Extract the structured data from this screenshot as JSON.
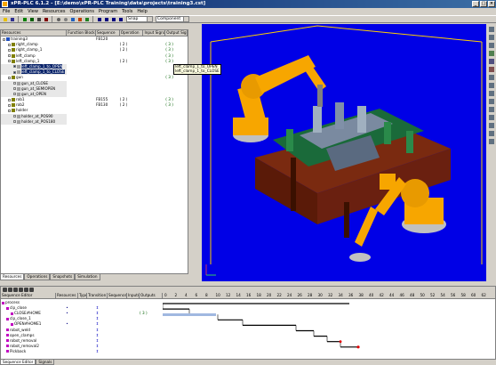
{
  "window": {
    "title": "xPR-PLC 6.1.2 - [E:\\demo\\xPR-PLC Training\\data\\projects\\training3.cst]"
  },
  "menu": [
    "File",
    "Edit",
    "View",
    "Resources",
    "Operations",
    "Program",
    "Tools",
    "Help"
  ],
  "toolbar": {
    "snap_combo": "Snap",
    "component_combo": "Component"
  },
  "tree": {
    "columns": [
      "Resources",
      "Function Block",
      "Sequence",
      "Operation",
      "Input Signals",
      "Output Signals"
    ],
    "rows": [
      {
        "name": "training3",
        "indent": 0,
        "sequence": "FB120",
        "operation": "",
        "input": "",
        "output": "",
        "sel": false
      },
      {
        "name": "right_clamp",
        "indent": 1,
        "sequence": "",
        "operation": "( 2 )",
        "input": "",
        "output": "( 3 )",
        "sel": false
      },
      {
        "name": "right_clamp_1",
        "indent": 1,
        "sequence": "",
        "operation": "( 2 )",
        "input": "",
        "output": "( 3 )",
        "sel": false
      },
      {
        "name": "left_clamp",
        "indent": 1,
        "sequence": "",
        "operation": "",
        "input": "",
        "output": "( 3 )",
        "sel": false
      },
      {
        "name": "left_clamp_1",
        "indent": 1,
        "sequence": "",
        "operation": "( 2 )",
        "input": "",
        "output": "( 3 )",
        "sel": false
      },
      {
        "name": "left_clamp_1_to_OPEN",
        "indent": 2,
        "sequence": "",
        "operation": "",
        "input": "",
        "output": "",
        "sel": true
      },
      {
        "name": "left_clamp_1_to_CLOSE",
        "indent": 2,
        "sequence": "",
        "operation": "",
        "input": "",
        "output": "",
        "sel": true
      },
      {
        "name": "gun",
        "indent": 1,
        "sequence": "",
        "operation": "",
        "input": "",
        "output": "( 3 )",
        "sel": false
      },
      {
        "name": "gun_at_CLOSE",
        "indent": 2,
        "sequence": "",
        "operation": "",
        "input": "",
        "output": "",
        "sel": false
      },
      {
        "name": "gun_at_SEMIOPEN",
        "indent": 2,
        "sequence": "",
        "operation": "",
        "input": "",
        "output": "",
        "sel": false
      },
      {
        "name": "gun_at_OPEN",
        "indent": 2,
        "sequence": "",
        "operation": "",
        "input": "",
        "output": "",
        "sel": false
      },
      {
        "name": "rob1",
        "indent": 1,
        "sequence": "FB155",
        "operation": "( 2 )",
        "input": "",
        "output": "( 3 )",
        "sel": false
      },
      {
        "name": "rob2",
        "indent": 1,
        "sequence": "FB130",
        "operation": "( 2 )",
        "input": "",
        "output": "( 3 )",
        "sel": false
      },
      {
        "name": "holder",
        "indent": 1,
        "sequence": "",
        "operation": "",
        "input": "",
        "output": "",
        "sel": false
      },
      {
        "name": "holder_at_POS90",
        "indent": 2,
        "sequence": "",
        "operation": "",
        "input": "",
        "output": "",
        "sel": false
      },
      {
        "name": "holder_at_POS180",
        "indent": 2,
        "sequence": "",
        "operation": "",
        "input": "",
        "output": "",
        "sel": false
      }
    ],
    "bottom_tabs": [
      "Resources",
      "Operations",
      "Snapshots",
      "Simulation"
    ]
  },
  "tooltip": {
    "line1": "left_clamp_1_to_OPEN",
    "line2": "left_clamp_1_to_CLOSE"
  },
  "sequence_editor": {
    "columns": [
      "Sequence Editor",
      "Resources",
      "Type",
      "Transition",
      "Sequence",
      "Inputs",
      "Outputs"
    ],
    "rows": [
      {
        "name": "process",
        "indent": 0,
        "resource": "",
        "transition": false
      },
      {
        "name": "clp_close",
        "indent": 1,
        "resource": "•",
        "transition": true
      },
      {
        "name": "CLOSE#HOME",
        "indent": 2,
        "resource": "•",
        "transition": true,
        "outputs": "( 3 )"
      },
      {
        "name": "clp_close_1",
        "indent": 1,
        "resource": "",
        "transition": true
      },
      {
        "name": "OPEN#HOME1",
        "indent": 2,
        "resource": "•",
        "transition": true
      },
      {
        "name": "robot_weld",
        "indent": 1,
        "resource": "",
        "transition": true
      },
      {
        "name": "open_clamps",
        "indent": 1,
        "resource": "",
        "transition": true
      },
      {
        "name": "robot_removal",
        "indent": 1,
        "resource": "",
        "transition": true
      },
      {
        "name": "robot_removal2",
        "indent": 1,
        "resource": "",
        "transition": true
      },
      {
        "name": "Pickback",
        "indent": 1,
        "resource": "",
        "transition": true
      }
    ],
    "timeline_ticks": [
      "0",
      "2",
      "4",
      "6",
      "8",
      "10",
      "12",
      "14",
      "16",
      "18",
      "20",
      "22",
      "24",
      "26",
      "28",
      "30",
      "32",
      "34",
      "36",
      "38",
      "40",
      "42",
      "44",
      "46",
      "48",
      "50",
      "52",
      "54",
      "56",
      "58",
      "60",
      "62"
    ],
    "bottom_tabs": [
      "Sequence Editor",
      "Signals"
    ]
  },
  "colors": {
    "viewport": "#0000e6",
    "robot": "#f7a600",
    "selection": "#0a246a"
  }
}
